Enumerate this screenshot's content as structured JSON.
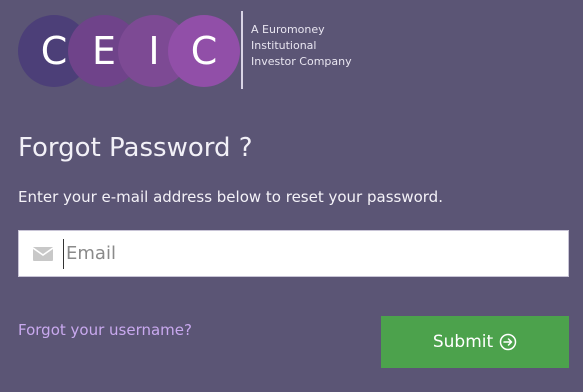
{
  "logo": {
    "letters": [
      "C",
      "E",
      "I",
      "C"
    ],
    "tagline_lines": [
      "A Euromoney",
      "Institutional",
      "Investor Company"
    ]
  },
  "form": {
    "title": "Forgot Password ?",
    "instruction": "Enter your e-mail address below to reset your password.",
    "email": {
      "placeholder": "Email",
      "value": ""
    },
    "forgot_username_link": "Forgot your username?",
    "submit_label": "Submit"
  },
  "colors": {
    "background": "#5b5575",
    "submit_button": "#4ca24c",
    "link": "#c9a9ef"
  },
  "icons": {
    "email_field": "envelope-icon",
    "submit": "circle-arrow-right-icon"
  }
}
